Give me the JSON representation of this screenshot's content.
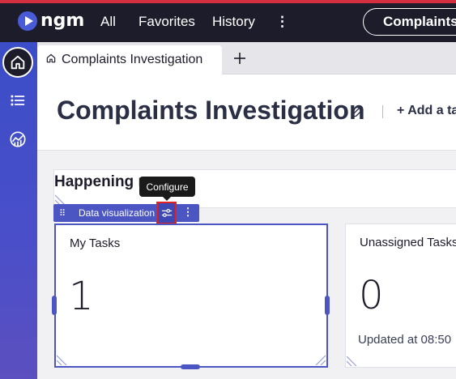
{
  "app": {
    "logo_text": "ngm"
  },
  "topnav": {
    "items": [
      "All",
      "Favorites",
      "History"
    ],
    "more_label": "⋮",
    "context_label": "Complaints In"
  },
  "sidebar": {
    "items": [
      {
        "icon": "home-icon"
      },
      {
        "icon": "list-icon"
      },
      {
        "icon": "analytics-icon"
      }
    ]
  },
  "tabs": {
    "active": "Complaints Investigation",
    "add_label": "+"
  },
  "header": {
    "title": "Complaints Investigation",
    "add_task_label": "+ Add a ta"
  },
  "section": {
    "title": "Happening n"
  },
  "tooltip": {
    "text": "Configure"
  },
  "widget_toolbar": {
    "drag_handle": "⠿",
    "label": "Data visualization",
    "more_label": "⋮"
  },
  "cards": [
    {
      "title": "My Tasks",
      "value": "1",
      "footer": ""
    },
    {
      "title": "Unassigned Tasks",
      "value": "0",
      "footer": "Updated at 08:50"
    }
  ],
  "colors": {
    "accent": "#4c56c2",
    "topbar": "#1c1c2b",
    "alert": "#d32f3f",
    "highlight": "#e02222"
  }
}
